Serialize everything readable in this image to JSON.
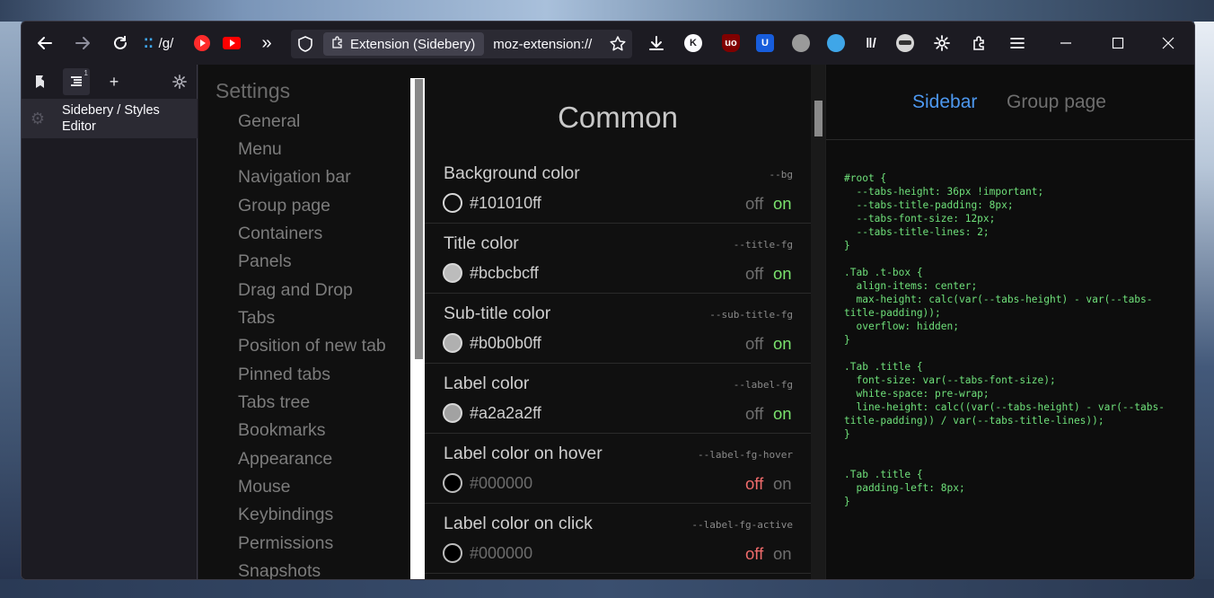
{
  "toolbar": {
    "shortcut_text": "/g/",
    "url_chip_label": "Extension (Sidebery)",
    "url_text": "moz-extension://",
    "ext_k_label": "K",
    "ext_ublock_label": "uo",
    "ext_bitwarden_label": "U"
  },
  "sidebery": {
    "nav_badge": "1",
    "tab_title": "Sidebery / Styles Editor"
  },
  "settings_nav": {
    "heading": "Settings",
    "items": [
      "General",
      "Menu",
      "Navigation bar",
      "Group page",
      "Containers",
      "Panels",
      "Drag and Drop",
      "Tabs",
      "Position of new tab",
      "Pinned tabs",
      "Tabs tree",
      "Bookmarks",
      "Appearance",
      "Mouse",
      "Keybindings",
      "Permissions",
      "Snapshots"
    ]
  },
  "main": {
    "title": "Common",
    "toggle_off_label": "off",
    "toggle_on_label": "on",
    "vars": [
      {
        "label": "Background color",
        "css": "--bg",
        "value": "#101010ff",
        "enabled": true,
        "swatch": "#101010"
      },
      {
        "label": "Title color",
        "css": "--title-fg",
        "value": "#bcbcbcff",
        "enabled": true,
        "swatch": "#bcbcbc"
      },
      {
        "label": "Sub-title color",
        "css": "--sub-title-fg",
        "value": "#b0b0b0ff",
        "enabled": true,
        "swatch": "#b0b0b0"
      },
      {
        "label": "Label color",
        "css": "--label-fg",
        "value": "#a2a2a2ff",
        "enabled": true,
        "swatch": "#a2a2a2"
      },
      {
        "label": "Label color on hover",
        "css": "--label-fg-hover",
        "value": "#000000",
        "enabled": false,
        "swatch": "#000000"
      },
      {
        "label": "Label color on click",
        "css": "--label-fg-active",
        "value": "#000000",
        "enabled": false,
        "swatch": "#000000"
      }
    ]
  },
  "editor": {
    "tabs": [
      "Sidebar",
      "Group page"
    ],
    "active_tab": "Sidebar",
    "code": "#root {\n  --tabs-height: 36px !important;\n  --tabs-title-padding: 8px;\n  --tabs-font-size: 12px;\n  --tabs-title-lines: 2;\n}\n\n.Tab .t-box {\n  align-items: center;\n  max-height: calc(var(--tabs-height) - var(--tabs-\ntitle-padding));\n  overflow: hidden;\n}\n\n.Tab .title {\n  font-size: var(--tabs-font-size);\n  white-space: pre-wrap;\n  line-height: calc((var(--tabs-height) - var(--tabs-\ntitle-padding)) / var(--tabs-title-lines));\n}\n\n\n.Tab .title {\n  padding-left: 8px;\n}"
  },
  "colors": {
    "accent_blue": "#4d98f0",
    "on_green": "#7be36e",
    "off_red": "#ef6b6b",
    "code_green": "#6fe07a"
  }
}
